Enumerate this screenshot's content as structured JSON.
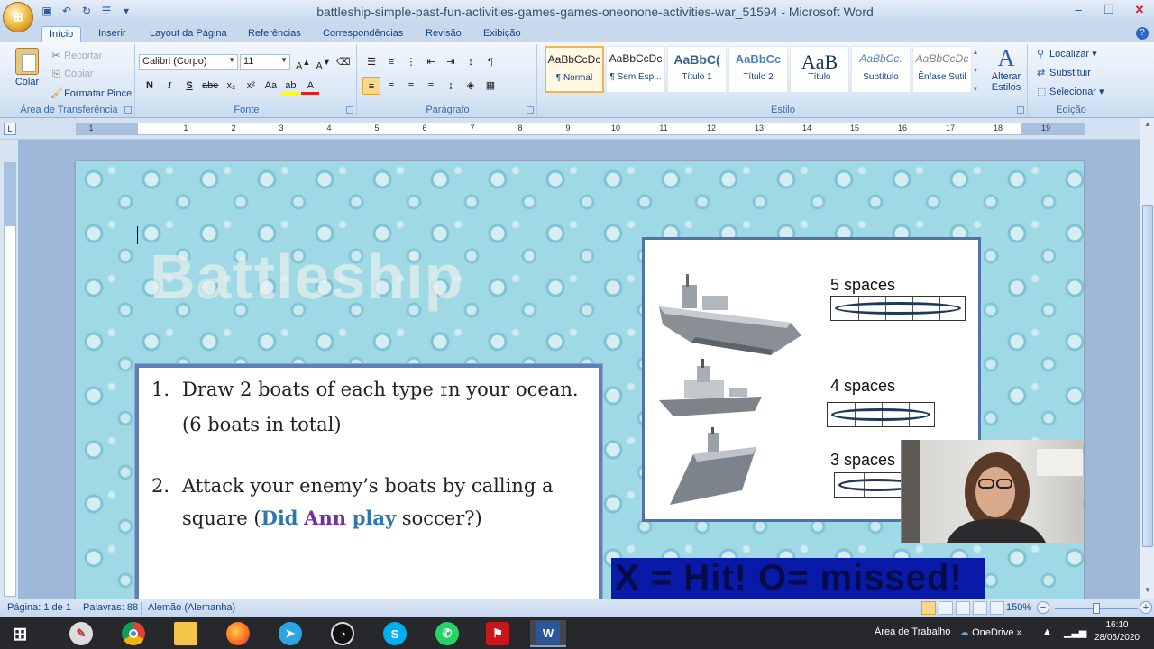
{
  "window": {
    "title": "battleship-simple-past-fun-activities-games-games-oneonone-activities-war_51594 - Microsoft Word",
    "controls": [
      "minimize",
      "restore",
      "close"
    ]
  },
  "quick_access": [
    "save-icon",
    "undo-icon",
    "redo-icon",
    "customize-icon"
  ],
  "tabs": [
    "Início",
    "Inserir",
    "Layout da Página",
    "Referências",
    "Correspondências",
    "Revisão",
    "Exibição"
  ],
  "active_tab": "Início",
  "ribbon": {
    "clipboard": {
      "paste": "Colar",
      "cut": "Recortar",
      "copy": "Copiar",
      "format_painter": "Formatar Pincel",
      "label": "Área de Transferência"
    },
    "font": {
      "name": "Calibri (Corpo)",
      "size": "11",
      "label": "Fonte",
      "buttons": [
        "N",
        "I",
        "S",
        "abe",
        "x₂",
        "x²",
        "Aa"
      ]
    },
    "paragraph": {
      "label": "Parágrafo"
    },
    "styles": {
      "label": "Estilo",
      "items": [
        {
          "sample": "AaBbCcDc",
          "name": "¶ Normal"
        },
        {
          "sample": "AaBbCcDc",
          "name": "¶ Sem Esp..."
        },
        {
          "sample": "AaBbC(",
          "name": "Título 1"
        },
        {
          "sample": "AaBbCc",
          "name": "Título 2"
        },
        {
          "sample": "AaB",
          "name": "Título"
        },
        {
          "sample": "AaBbCc.",
          "name": "Subtítulo"
        },
        {
          "sample": "AaBbCcDc",
          "name": "Ênfase Sutil"
        }
      ],
      "change_styles": "Alterar Estilos"
    },
    "editing": {
      "label": "Edição",
      "find": "Localizar",
      "replace": "Substituir",
      "select": "Selecionar"
    }
  },
  "ruler": {
    "numbers": [
      "1",
      "1",
      "2",
      "3",
      "4",
      "5",
      "6",
      "7",
      "8",
      "9",
      "10",
      "11",
      "12",
      "13",
      "14",
      "15",
      "16",
      "17",
      "18",
      "19"
    ]
  },
  "document": {
    "title": "Battleship",
    "instructions": [
      {
        "num": "1.",
        "text_a": "Draw 2 boats of each type ",
        "cursor": "I",
        "text_b": "n your ocean. (6 boats in total)"
      },
      {
        "num": "2.",
        "text_a": "Attack your enemy’s  boats by calling a square (",
        "q1": "Did",
        "q2": "Ann",
        "q3": "play",
        "text_b": " soccer?)"
      }
    ],
    "ships": [
      {
        "label": "5 spaces",
        "cells": 5
      },
      {
        "label": "4 spaces",
        "cells": 4
      },
      {
        "label": "3 spaces",
        "cells": 3
      }
    ],
    "legend": "X = Hit!  O= missed!"
  },
  "status_bar": {
    "page": "Página: 1 de 1",
    "words": "Palavras: 88",
    "language": "Alemão (Alemanha)",
    "zoom": "150%"
  },
  "taskbar": {
    "apps": [
      "windows-start-icon",
      "chrome-icon",
      "file-explorer-icon",
      "firefox-icon",
      "telegram-icon",
      "obs-icon",
      "skype-icon",
      "whatsapp-icon",
      "acrobat-icon",
      "word-icon"
    ],
    "desktop_label": "Área de Trabalho",
    "onedrive": "OneDrive",
    "time": "16:10",
    "date": "28/05/2020"
  },
  "colors": {
    "ribbon_bg": "#dbe7f6",
    "page_water": "#9fd9e6",
    "frame_blue": "#5b7fb6",
    "q_blue": "#2e75b6",
    "q_purple": "#7030a0",
    "taskbar": "#27282c"
  }
}
